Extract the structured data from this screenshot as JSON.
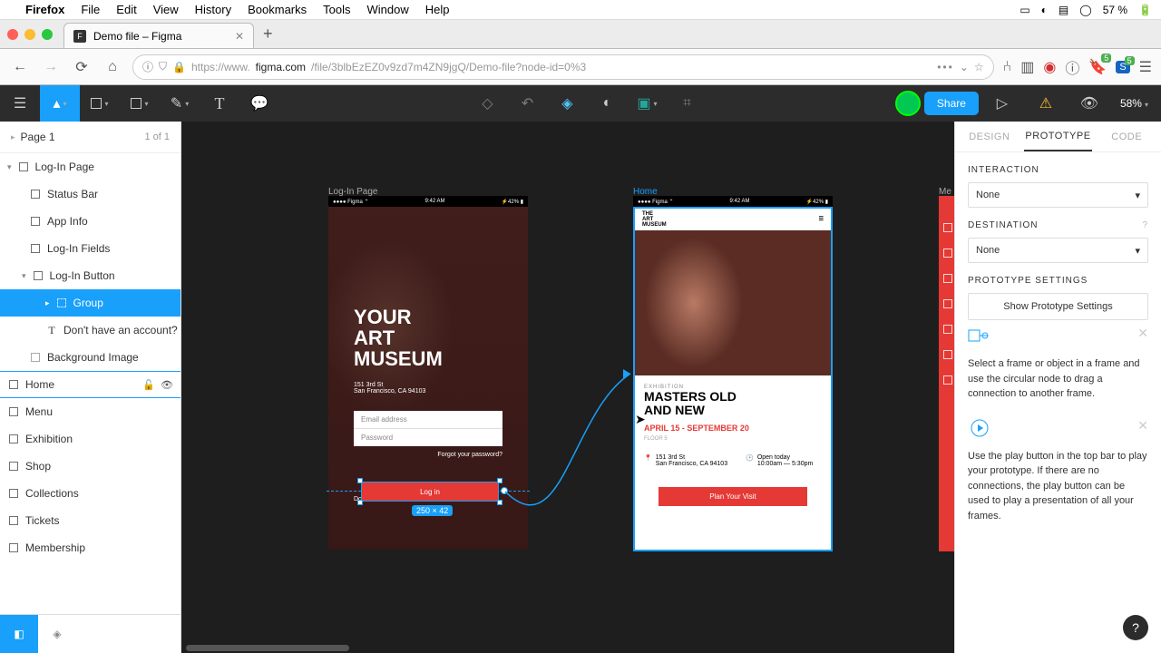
{
  "mac_menu": {
    "items": [
      "Firefox",
      "File",
      "Edit",
      "View",
      "History",
      "Bookmarks",
      "Tools",
      "Window",
      "Help"
    ],
    "battery": "57 %"
  },
  "browser": {
    "tab_title": "Demo file – Figma",
    "url_prefix": "https://www.",
    "url_host": "figma.com",
    "url_rest": "/file/3blbEzEZ0v9zd7m4ZN9jgQ/Demo-file?node-id=0%3"
  },
  "figma": {
    "share": "Share",
    "zoom": "58%"
  },
  "pages": {
    "name": "Page 1",
    "count": "1 of 1"
  },
  "layers": {
    "login_page": "Log-In Page",
    "status_bar": "Status Bar",
    "app_info": "App Info",
    "login_fields": "Log-In Fields",
    "login_button": "Log-In Button",
    "group": "Group",
    "no_account": "Don't have an account?",
    "bg_image": "Background Image",
    "home": "Home",
    "menu": "Menu",
    "exhibition": "Exhibition",
    "shop": "Shop",
    "collections": "Collections",
    "tickets": "Tickets",
    "membership": "Membership"
  },
  "canvas": {
    "login_label": "Log-In Page",
    "home_label": "Home",
    "menu_label": "Me",
    "status_time": "9:42 AM",
    "status_carrier": "Figma",
    "status_batt": "42%",
    "login_title_l1": "YOUR",
    "login_title_l2": "ART",
    "login_title_l3": "MUSEUM",
    "addr1": "151 3rd St",
    "addr2": "San Francisco, CA 94103",
    "email_ph": "Email address",
    "pwd_ph": "Password",
    "forgot": "Forgot your password?",
    "login_btn": "Log in",
    "no_account_txt": "Don't have an accou",
    "dims": "250 × 42",
    "art_museum_l1": "THE",
    "art_museum_l2": "ART",
    "art_museum_l3": "MUSEUM",
    "exh_label": "EXHIBITION",
    "exh_title": "MASTERS OLD AND NEW",
    "exh_dates": "APRIL 15 - SEPTEMBER 20",
    "exh_floor": "FLOOR 5",
    "home_addr1": "151 3rd St",
    "home_addr2": "San Francisco, CA 94103",
    "open1": "Open today",
    "open2": "10:00am — 5:30pm",
    "plan_btn": "Plan Your Visit"
  },
  "right": {
    "tabs": [
      "DESIGN",
      "PROTOTYPE",
      "CODE"
    ],
    "interaction": "INTERACTION",
    "destination": "DESTINATION",
    "none": "None",
    "proto_settings": "PROTOTYPE SETTINGS",
    "show_proto": "Show Prototype Settings",
    "hint1": "Select a frame or object in a frame and use the circular node to drag a connection to another frame.",
    "hint2": "Use the play button in the top bar to play your prototype. If there are no connections, the play button can be used to play a presentation of all your frames."
  }
}
